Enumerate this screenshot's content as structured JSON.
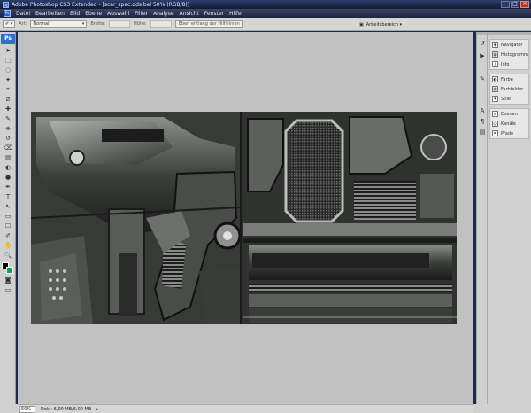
{
  "window": {
    "title": "Adobe Photoshop CS3 Extended - [scar_spec.dds bei 50% (RGB/8)]",
    "app_icon": "Ps"
  },
  "menubar": {
    "items": [
      "Datei",
      "Bearbeiten",
      "Bild",
      "Ebene",
      "Auswahl",
      "Filter",
      "Analyse",
      "Ansicht",
      "Fenster",
      "Hilfe"
    ]
  },
  "options": {
    "art_label": "Art:",
    "art_value": "Normal",
    "breite_label": "Breite:",
    "hoehe_label": "Höhe:",
    "eben_button": "Eben entlang der Hilfslinien",
    "workspace_label": "Arbeitsbereich ▾"
  },
  "toolbox": {
    "logo": "Ps",
    "tools": [
      "move-tool-icon",
      "marquee-tool-icon",
      "lasso-tool-icon",
      "magic-wand-icon",
      "crop-tool-icon",
      "slice-tool-icon",
      "healing-brush-icon",
      "brush-tool-icon",
      "clone-stamp-icon",
      "history-brush-icon",
      "eraser-tool-icon",
      "gradient-tool-icon",
      "blur-tool-icon",
      "dodge-tool-icon",
      "pen-tool-icon",
      "type-tool-icon",
      "path-select-icon",
      "shape-tool-icon",
      "notes-tool-icon",
      "eyedropper-icon",
      "hand-tool-icon",
      "zoom-tool-icon"
    ],
    "glyphs": [
      "➤",
      "⬚",
      "◌",
      "✦",
      "⌗",
      "⧄",
      "✚",
      "✎",
      "⎈",
      "↺",
      "⌫",
      "▥",
      "◐",
      "●",
      "✒",
      "T",
      "↖",
      "▭",
      "☐",
      "✐",
      "✋",
      "🔍"
    ],
    "foreground_color": "#000000",
    "background_color": "#11a04b"
  },
  "dock": {
    "groups": [
      {
        "items": [
          {
            "label": "Navigator",
            "icon": "navigator-icon",
            "glyph": "◈"
          },
          {
            "label": "Histogramm",
            "icon": "histogram-icon",
            "glyph": "▦"
          },
          {
            "label": "Info",
            "icon": "info-icon",
            "glyph": "i"
          }
        ]
      },
      {
        "items": [
          {
            "label": "Farbe",
            "icon": "color-icon",
            "glyph": "◐"
          },
          {
            "label": "Farbfelder",
            "icon": "swatches-icon",
            "glyph": "▦"
          },
          {
            "label": "Stile",
            "icon": "styles-icon",
            "glyph": "✦"
          }
        ]
      },
      {
        "items": [
          {
            "label": "Ebenen",
            "icon": "layers-icon",
            "glyph": "≡"
          },
          {
            "label": "Kanäle",
            "icon": "channels-icon",
            "glyph": "◎"
          },
          {
            "label": "Pfade",
            "icon": "paths-icon",
            "glyph": "✒"
          }
        ]
      }
    ]
  },
  "statusbar": {
    "zoom": "50%",
    "doc_info": "Dok.: 6,00 MB/6,00 MB"
  }
}
